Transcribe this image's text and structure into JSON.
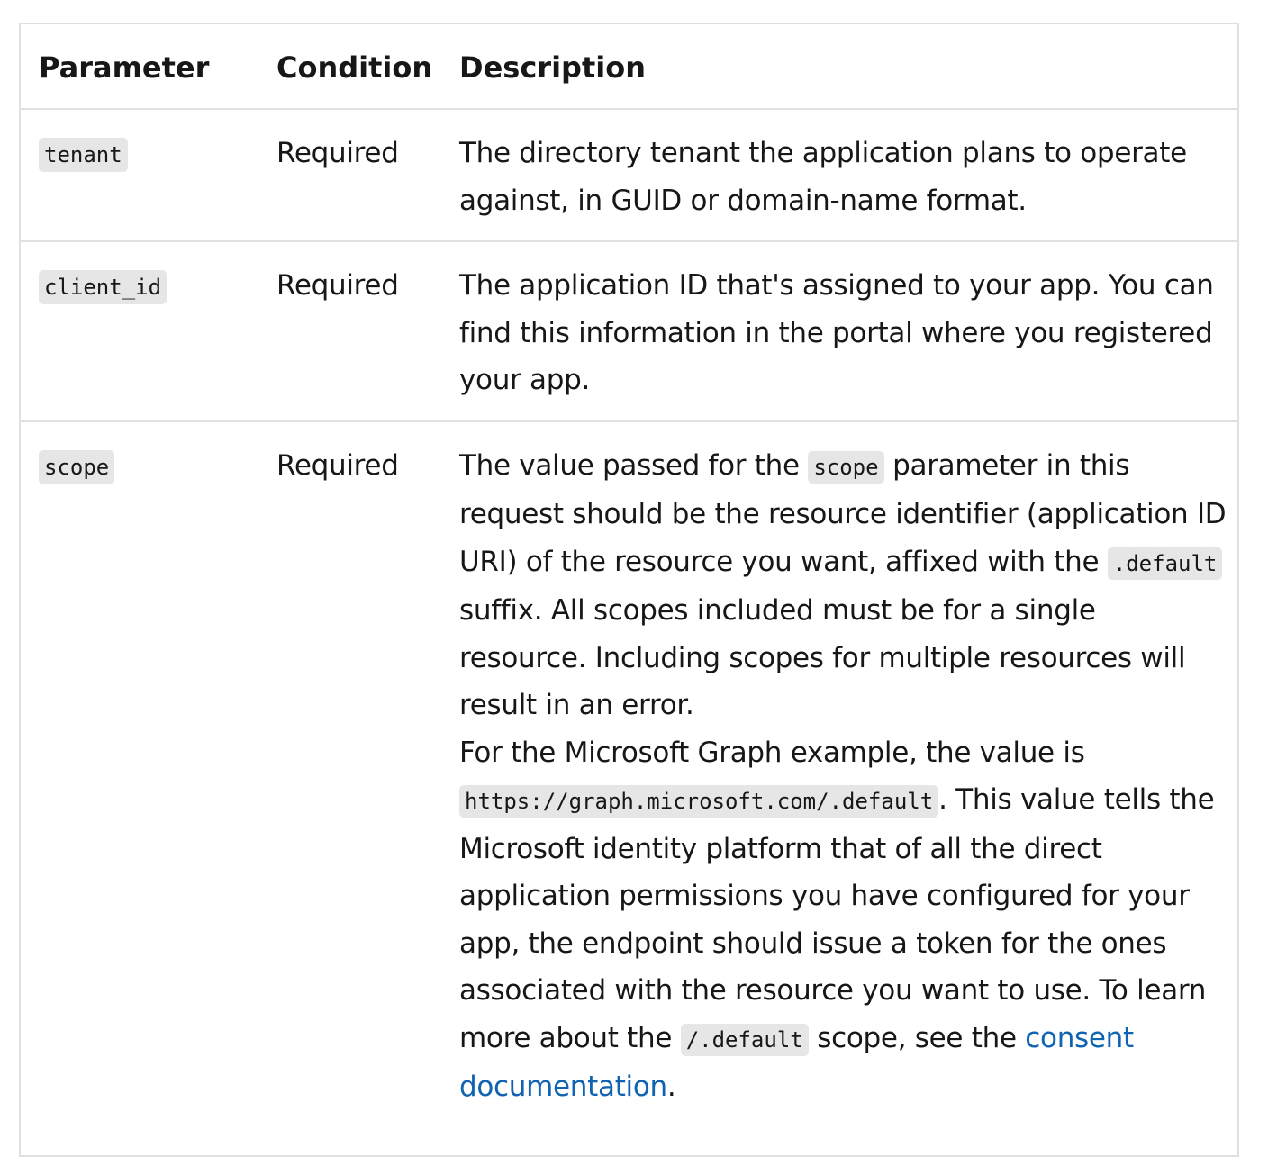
{
  "table": {
    "headers": {
      "parameter": "Parameter",
      "condition": "Condition",
      "description": "Description"
    },
    "rows": [
      {
        "parameter": "tenant",
        "condition": "Required",
        "description": "The directory tenant the application plans to operate against, in GUID or domain-name format."
      },
      {
        "parameter": "client_id",
        "condition": "Required",
        "description": "The application ID that's assigned to your app. You can find this information in the portal where you registered your app."
      },
      {
        "parameter": "scope",
        "condition": "Required",
        "description": {
          "p1_a": "The value passed for the ",
          "p1_code1": "scope",
          "p1_b": " parameter in this request should be the resource identifier (application ID URI) of the resource you want, affixed with the ",
          "p1_code2": ".default",
          "p1_c": " suffix. All scopes included must be for a single resource. Including scopes for multiple resources will result in an error.",
          "p2_a": "For the Microsoft Graph example, the value is ",
          "p2_code1": "https://graph.microsoft.com/.default",
          "p2_b": ". This value tells the Microsoft identity platform that of all the direct application permissions you have configured for your app, the endpoint should issue a token for the ones associated with the resource you want to use. To learn more about the ",
          "p2_code2": "/.default",
          "p2_c": " scope, see the ",
          "p2_link": "consent documentation",
          "p2_d": "."
        }
      }
    ]
  }
}
